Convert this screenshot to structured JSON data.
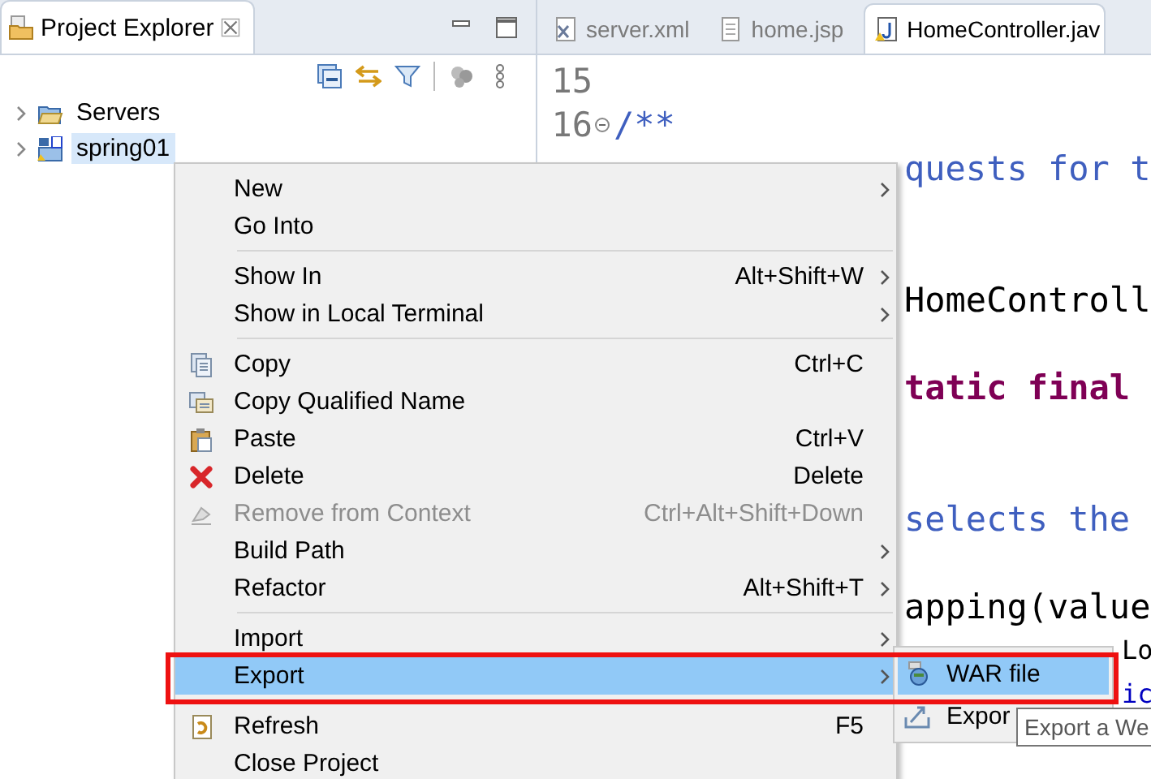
{
  "explorer": {
    "title": "Project Explorer",
    "tree": [
      {
        "label": "Servers",
        "kind": "folder",
        "selected": false,
        "expanded": false
      },
      {
        "label": "spring01",
        "kind": "project",
        "selected": true,
        "expanded": false
      }
    ]
  },
  "editor": {
    "tabs": [
      {
        "label": "server.xml",
        "kind": "xml",
        "selected": false
      },
      {
        "label": "home.jsp",
        "kind": "jsp",
        "selected": false
      },
      {
        "label": "HomeController.jav",
        "kind": "java",
        "selected": true
      }
    ],
    "lines": [
      {
        "number": "15",
        "kind": "numbered",
        "fold": false
      },
      {
        "number": "16",
        "text": "/**",
        "kind": "numbered",
        "fold": true
      },
      {
        "text": "quests for t",
        "kind": "fragment"
      },
      {
        "kind": "fragment"
      },
      {
        "kind": "fragment"
      },
      {
        "text": "HomeControll",
        "kind": "fragment"
      },
      {
        "kind": "fragment"
      },
      {
        "text": "tatic final",
        "kind": "fragment"
      },
      {
        "kind": "fragment"
      },
      {
        "kind": "fragment"
      },
      {
        "text": "selects the",
        "kind": "fragment"
      },
      {
        "kind": "fragment"
      },
      {
        "text": "apping(value",
        "kind": "fragment"
      },
      {
        "text": "Lo",
        "kind": "tail"
      },
      {
        "text": "ic",
        "kind": "tail"
      }
    ]
  },
  "context_menu": {
    "items": [
      {
        "kind": "item",
        "label": "New",
        "submenu": true,
        "disabled": false,
        "selected": false
      },
      {
        "kind": "item",
        "label": "Go Into",
        "submenu": false,
        "disabled": false,
        "selected": false
      },
      {
        "kind": "separator"
      },
      {
        "kind": "item",
        "label": "Show In",
        "shortcut": "Alt+Shift+W",
        "submenu": true,
        "disabled": false,
        "selected": false
      },
      {
        "kind": "item",
        "label": "Show in Local Terminal",
        "submenu": true,
        "disabled": false,
        "selected": false
      },
      {
        "kind": "separator"
      },
      {
        "kind": "item",
        "label": "Copy",
        "shortcut": "Ctrl+C",
        "submenu": false,
        "disabled": false,
        "selected": false
      },
      {
        "kind": "item",
        "label": "Copy Qualified Name",
        "submenu": false,
        "disabled": false,
        "selected": false
      },
      {
        "kind": "item",
        "label": "Paste",
        "shortcut": "Ctrl+V",
        "submenu": false,
        "disabled": false,
        "selected": false
      },
      {
        "kind": "item",
        "label": "Delete",
        "shortcut": "Delete",
        "submenu": false,
        "disabled": false,
        "selected": false
      },
      {
        "kind": "item",
        "label": "Remove from Context",
        "shortcut": "Ctrl+Alt+Shift+Down",
        "submenu": false,
        "disabled": true,
        "selected": false
      },
      {
        "kind": "item",
        "label": "Build Path",
        "submenu": true,
        "disabled": false,
        "selected": false
      },
      {
        "kind": "item",
        "label": "Refactor",
        "shortcut": "Alt+Shift+T",
        "submenu": true,
        "disabled": false,
        "selected": false
      },
      {
        "kind": "separator"
      },
      {
        "kind": "item",
        "label": "Import",
        "submenu": true,
        "disabled": false,
        "selected": false
      },
      {
        "kind": "item",
        "label": "Export",
        "submenu": true,
        "disabled": false,
        "selected": true
      },
      {
        "kind": "separator"
      },
      {
        "kind": "item",
        "label": "Refresh",
        "shortcut": "F5",
        "submenu": false,
        "disabled": false,
        "selected": false
      },
      {
        "kind": "item",
        "label": "Close Project",
        "submenu": false,
        "disabled": false,
        "selected": false
      }
    ]
  },
  "submenu": {
    "items": [
      {
        "label": "WAR file",
        "selected": true
      },
      {
        "label": "Expor",
        "selected": false
      }
    ]
  },
  "tooltip": {
    "text": "Export a We"
  }
}
